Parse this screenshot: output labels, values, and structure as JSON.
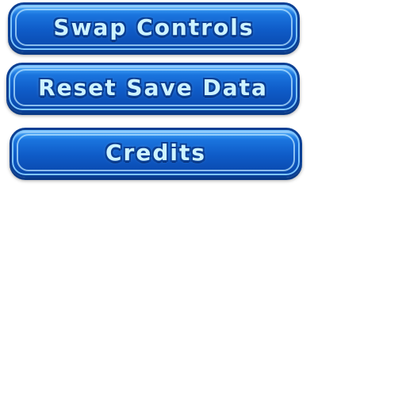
{
  "menu": {
    "buttons": [
      {
        "label": "Swap Controls"
      },
      {
        "label": "Reset Save Data"
      },
      {
        "label": "Credits"
      }
    ]
  },
  "colors": {
    "button_fill": "#0f5cc8",
    "button_border": "#0a3f94",
    "button_highlight": "#7fc6ff",
    "label_text": "#cdf3ff",
    "background": "#ffffff"
  }
}
